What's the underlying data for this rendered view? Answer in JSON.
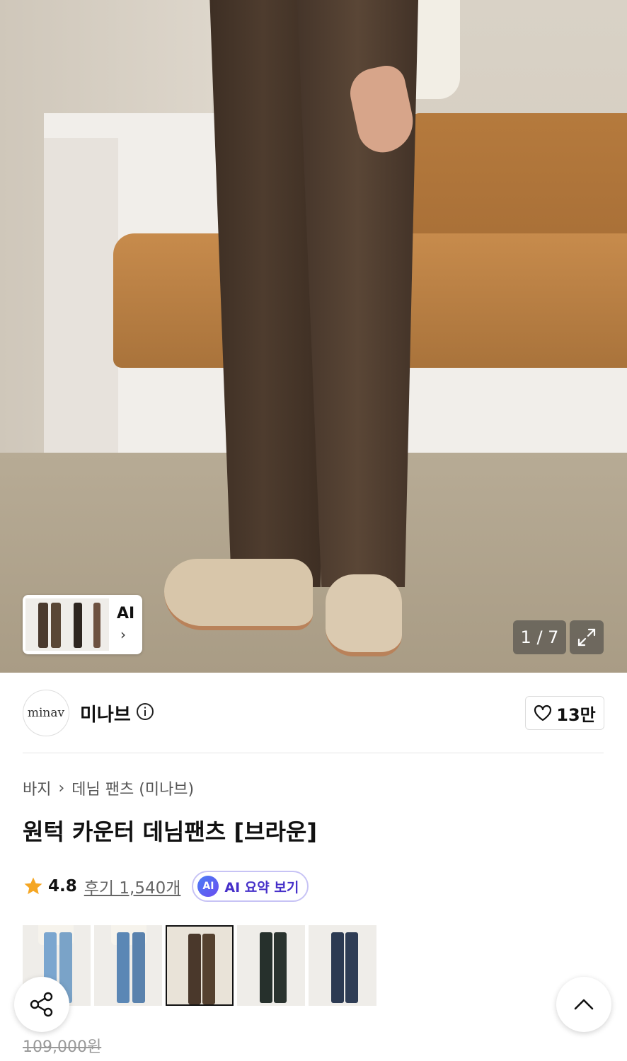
{
  "gallery": {
    "counter": "1 / 7",
    "ai_label": "AI",
    "ai_chevron": "›"
  },
  "brand": {
    "logo_text": "minav",
    "name": "미나브",
    "likes": "13만"
  },
  "breadcrumb": {
    "category": "바지",
    "separator": "›",
    "subcategory": "데님 팬츠 (미나브)"
  },
  "product": {
    "title": "원턱 카운터 데님팬츠 [브라운]",
    "rating": "4.8",
    "reviews": "후기 1,540개",
    "ai_badge": "AI",
    "ai_summary": "AI 요약 보기",
    "original_price": "109,000원"
  },
  "colors": {
    "swatches": [
      "light-blue",
      "mid-blue",
      "brown",
      "black",
      "navy"
    ],
    "selected": "brown"
  },
  "theme": {
    "accent": "#4630c9",
    "star": "#f5a623"
  }
}
